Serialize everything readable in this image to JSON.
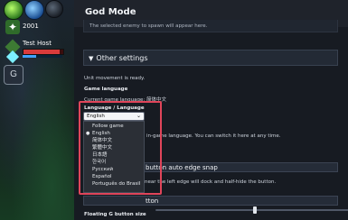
{
  "hud": {
    "coins": "2001",
    "player_name": "Test Host",
    "hp_fraction": 0.92,
    "mp_fraction": 0.35,
    "g_button_label": "G"
  },
  "panel": {
    "title": "God Mode",
    "notice": "The selected enemy to spawn will appear here.",
    "other_settings_label": "Other settings",
    "unit_movement_ready": "Unit movement is ready.",
    "game_language_label": "Game language",
    "current_game_language": "Current game language: 简体中文",
    "language_label": "Language / Language",
    "language_hint": "in-game language. You can switch it here at any time.",
    "auto_edge_snap_label": "button auto edge snap",
    "edge_snap_hint": "near the left edge will dock and half-hide the button.",
    "second_section_label": "tton",
    "floating_g_button_size": "Floating G button size",
    "slider_value": 0.48
  },
  "language_select": {
    "selected": "English",
    "chevron_icon": "chevron-down-icon",
    "options": [
      {
        "label": "Follow game",
        "selected": false
      },
      {
        "label": "English",
        "selected": true
      },
      {
        "label": "简体中文",
        "selected": false
      },
      {
        "label": "繁體中文",
        "selected": false
      },
      {
        "label": "日本語",
        "selected": false
      },
      {
        "label": "한국어",
        "selected": false
      },
      {
        "label": "Русский",
        "selected": false
      },
      {
        "label": "Español",
        "selected": false
      },
      {
        "label": "Português do Brasil",
        "selected": false
      }
    ]
  },
  "colors": {
    "highlight": "#e0455a",
    "panel_bg": "#171b22",
    "hp": "#d93b3b",
    "mp": "#3fa2ff"
  }
}
